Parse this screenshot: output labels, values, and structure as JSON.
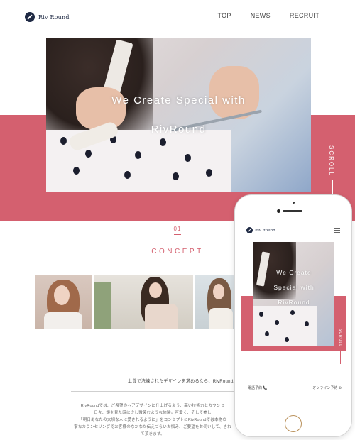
{
  "brand": {
    "name": "Riv Round"
  },
  "nav": {
    "items": [
      "TOP",
      "NEWS",
      "RECRUIT"
    ]
  },
  "hero": {
    "title_line1": "We Create Special with",
    "title_line2": "RivRound",
    "scroll_label": "SCROLL"
  },
  "concept": {
    "number": "01",
    "title": "CONCEPT"
  },
  "content": {
    "tagline": "上質で洗練されたデザインを求めるなら、RivRound。",
    "body_lines": [
      "RivRoundでは、ご希望のヘアデザインに仕上げるよう、高い技術力とカウンセ",
      "日々、鏡を見た時に少し微笑むような体験。可愛く、そして美し",
      "「明日あなたの大切な人に愛されるように」をコンセプトにRivRoundでは本物の",
      "寧なカウンセリングでお客様のなかなか伝えづらいお悩み、ご要望をお伺いして、きれ",
      "て頂きます。"
    ]
  },
  "phone": {
    "brand": "Riv Round",
    "hero_line1": "We Create",
    "hero_line2": "Special with",
    "hero_line3": "RivRound",
    "scroll_label": "SCROLL",
    "call_label": "電話予約 📞",
    "online_label": "オンライン予約 ⊘"
  },
  "colors": {
    "accent": "#d4606f",
    "brand_navy": "#1f2a44",
    "home_button": "#b9905a"
  },
  "icons": {
    "logo": "riv-round-logo-icon",
    "menu": "hamburger-menu-icon",
    "phone": "phone-icon",
    "home": "home-button-icon"
  }
}
